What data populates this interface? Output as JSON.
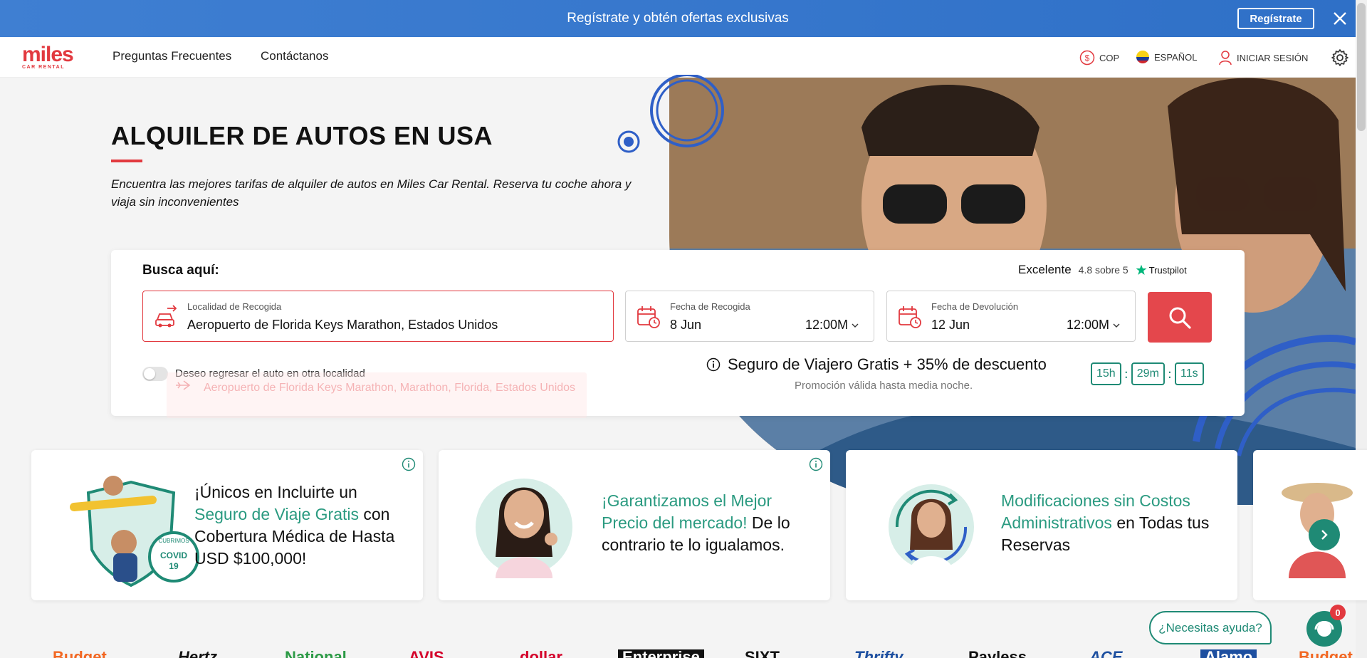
{
  "promo_banner": {
    "text": "Regístrate y obtén ofertas exclusivas",
    "button_label": "Regístrate",
    "close_icon": "close-icon"
  },
  "nav": {
    "logo_text": "miles",
    "logo_subtext": "CAR RENTAL",
    "links": [
      "Preguntas Frecuentes",
      "Contáctanos"
    ],
    "currency": "COP",
    "language": "ESPAÑOL",
    "login": "INICIAR SESIÓN"
  },
  "hero": {
    "title": "ALQUILER DE AUTOS EN USA",
    "subtitle": "Encuentra las mejores tarifas de alquiler de autos en Miles Car Rental. Reserva tu coche ahora y viaja sin inconvenientes"
  },
  "search": {
    "heading": "Busca aquí:",
    "trustpilot": {
      "rating_text": "Excelente",
      "score": "4.8 sobre 5",
      "brand": "Trustpilot"
    },
    "pickup_location": {
      "label": "Localidad de Recogida",
      "value": "Aeropuerto de Florida Keys Marathon, Estados Unidos"
    },
    "pickup_date": {
      "label": "Fecha de Recogida",
      "date": "8 Jun",
      "time": "12:00M"
    },
    "return_date": {
      "label": "Fecha de Devolución",
      "date": "12 Jun",
      "time": "12:00M"
    },
    "return_other_label": "Deseo regresar el auto en otra localidad",
    "suggestion": "Aeropuerto de Florida Keys Marathon, Marathon, Florida, Estados Unidos",
    "insurance_promo": "Seguro de Viajero Gratis + 35% de descuento",
    "promo_validity": "Promoción válida hasta media noche.",
    "timer": {
      "hours": "15h",
      "minutes": "29m",
      "seconds": "11s"
    }
  },
  "benefits": [
    {
      "pre": "¡Únicos en Incluirte un ",
      "highlight": "Seguro de Viaje Gratis",
      "post": " con Cobertura Médica de Hasta USD $100,000!",
      "badge_top": "CUBRIMOS",
      "badge_main": "COVID",
      "badge_sub": "19"
    },
    {
      "pre": "",
      "highlight": "¡Garantizamos el Mejor Precio del mercado!",
      "post": " De lo contrario te lo igualamos."
    },
    {
      "pre": "",
      "highlight": "Modificaciones sin Costos Administrativos",
      "post": " en Todas tus Reservas"
    }
  ],
  "help": {
    "label": "¿Necesitas ayuda?",
    "badge_count": "0"
  },
  "brands": [
    "Budget",
    "Hertz",
    "National",
    "AVIS",
    "dollar",
    "Enterprise",
    "SIXT",
    "Thrifty",
    "Payless",
    "ACE",
    "Alamo",
    "Budget"
  ],
  "colors": {
    "accent_red": "#e2393f",
    "accent_teal": "#1f8a75",
    "banner_blue": "#3573c9"
  }
}
